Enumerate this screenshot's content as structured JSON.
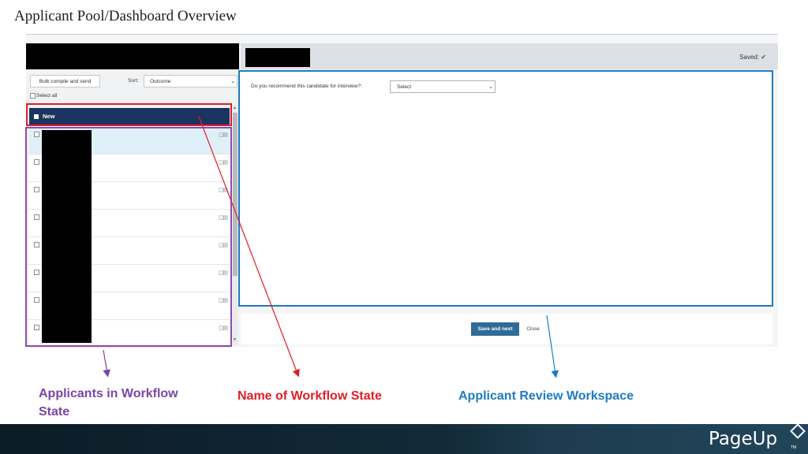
{
  "slide": {
    "title": "Applicant Pool/Dashboard Overview"
  },
  "left_panel": {
    "bulk_button": "Bulk compile and send",
    "sort_label": "Sort:",
    "sort_value": "Outcome",
    "select_all": "Select all",
    "workflow_state": "New",
    "applicant_rows": 8
  },
  "workspace": {
    "saved_label": "Saved:",
    "question": "Do you recommend this candidate for interview?:",
    "question_select": "Select",
    "save_next": "Save and next",
    "close": "Close"
  },
  "annotations": {
    "applicants": "Applicants in Workflow State",
    "workflow_name": "Name of Workflow State",
    "review_workspace": "Applicant Review Workspace"
  },
  "colors": {
    "red": "#e01e26",
    "purple": "#8d4bb0",
    "blue": "#1f7bbf",
    "state_bar": "#1c3560"
  },
  "brand": {
    "logo": "PageUp",
    "trademark": "TM"
  }
}
